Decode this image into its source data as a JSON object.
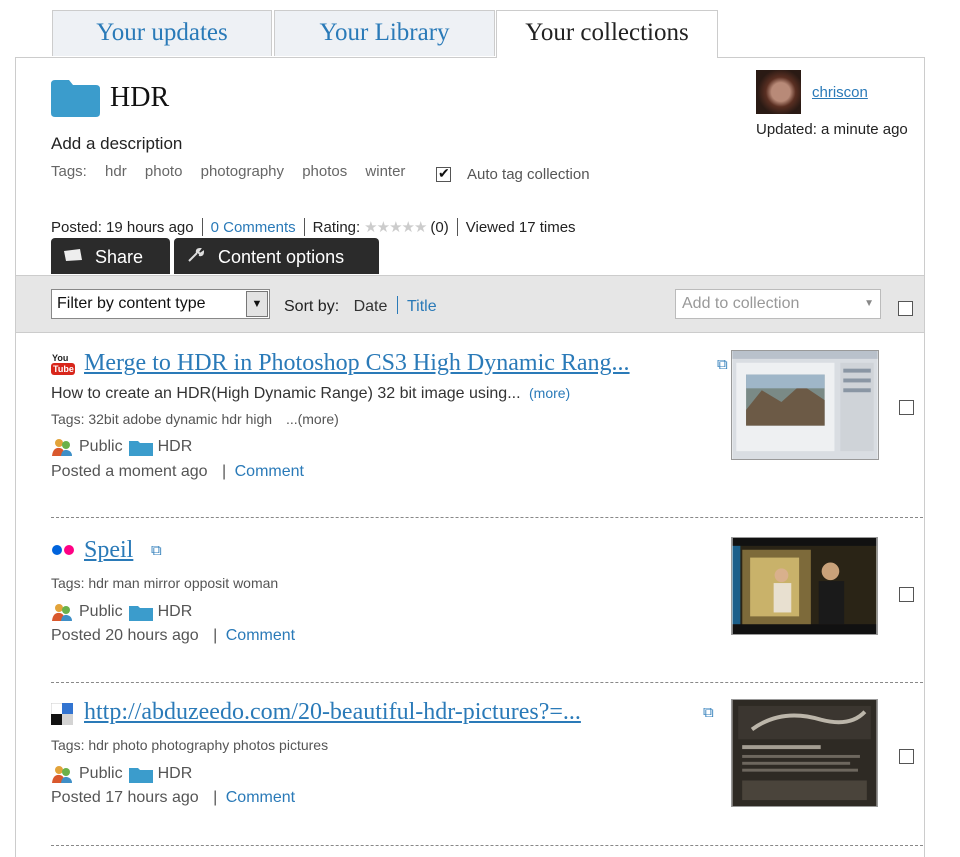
{
  "tabs": [
    {
      "label": "Your updates"
    },
    {
      "label": "Your Library"
    },
    {
      "label": "Your collections"
    }
  ],
  "collection": {
    "title": "HDR",
    "description_prompt": "Add a description",
    "tags_label": "Tags:",
    "tags": [
      "hdr",
      "photo",
      "photography",
      "photos",
      "winter"
    ],
    "auto_tag_label": "Auto tag collection",
    "auto_tag_checked": true,
    "author": "chriscon",
    "updated": "Updated: a minute ago",
    "posted": "Posted: 19 hours ago",
    "comments": "0 Comments",
    "rating_label": "Rating:",
    "rating_count": "(0)",
    "viewed": "Viewed 17 times"
  },
  "actions": {
    "share": "Share",
    "content_options": "Content options"
  },
  "filter_bar": {
    "filter_select": "Filter by content type",
    "sort_label": "Sort by:",
    "sort_date": "Date",
    "sort_title": "Title",
    "add_to_collection": "Add to collection"
  },
  "items": [
    {
      "source_icon": "youtube-icon",
      "title": "Merge to HDR in Photoshop CS3 High Dynamic Rang...",
      "description": "How to create an HDR(High Dynamic Range) 32 bit image using...",
      "more": "(more)",
      "tags": "Tags: 32bit adobe dynamic hdr high",
      "tags_more": "...(more)",
      "visibility": "Public",
      "collection": "HDR",
      "posted": "Posted a moment ago",
      "comment": "Comment"
    },
    {
      "source_icon": "flickr-icon",
      "title": "Speil",
      "tags": "Tags: hdr man mirror opposit woman",
      "visibility": "Public",
      "collection": "HDR",
      "posted": "Posted 20 hours ago",
      "comment": "Comment"
    },
    {
      "source_icon": "delicious-icon",
      "title": "http://abduzeedo.com/20-beautiful-hdr-pictures?=...",
      "tags": "Tags: hdr photo photography photos pictures",
      "visibility": "Public",
      "collection": "HDR",
      "posted": "Posted 17 hours ago",
      "comment": "Comment"
    }
  ],
  "colors": {
    "link": "#2a7ab8",
    "folder": "#3b9ccc",
    "dark_button": "#2b2b2b",
    "filter_bar": "#e6e6e6"
  }
}
